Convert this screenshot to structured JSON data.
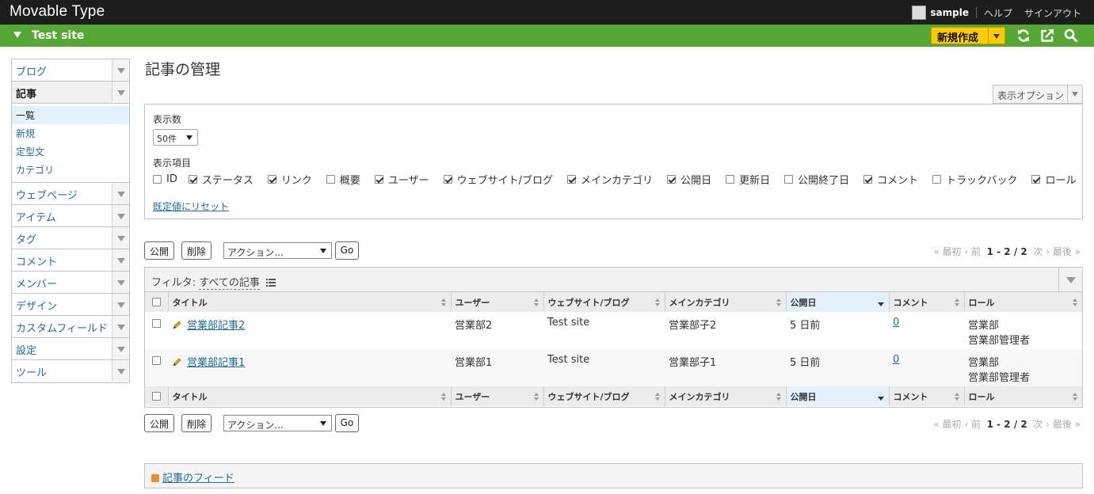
{
  "app": {
    "title": "Movable Type"
  },
  "user": {
    "name": "sample",
    "help": "ヘルプ",
    "signout": "サインアウト"
  },
  "site": {
    "name": "Test site",
    "new_button": "新規作成"
  },
  "sidebar": {
    "items": [
      {
        "label": "ブログ"
      },
      {
        "label": "記事"
      },
      {
        "label": "ウェブページ"
      },
      {
        "label": "アイテム"
      },
      {
        "label": "タグ"
      },
      {
        "label": "コメント"
      },
      {
        "label": "メンバー"
      },
      {
        "label": "デザイン"
      },
      {
        "label": "カスタムフィールド"
      },
      {
        "label": "設定"
      },
      {
        "label": "ツール"
      }
    ],
    "subitems": [
      {
        "label": "一覧"
      },
      {
        "label": "新規"
      },
      {
        "label": "定型文"
      },
      {
        "label": "カテゴリ"
      }
    ]
  },
  "page": {
    "title": "記事の管理",
    "display_options": "表示オプション"
  },
  "options": {
    "per_page_label": "表示数",
    "per_page_value": "50件",
    "columns_label": "表示項目",
    "columns": [
      {
        "label": "ID",
        "checked": false
      },
      {
        "label": "ステータス",
        "checked": true
      },
      {
        "label": "リンク",
        "checked": true
      },
      {
        "label": "概要",
        "checked": false
      },
      {
        "label": "ユーザー",
        "checked": true
      },
      {
        "label": "ウェブサイト/ブログ",
        "checked": true
      },
      {
        "label": "メインカテゴリ",
        "checked": true
      },
      {
        "label": "公開日",
        "checked": true
      },
      {
        "label": "更新日",
        "checked": false
      },
      {
        "label": "公開終了日",
        "checked": false
      },
      {
        "label": "コメント",
        "checked": true
      },
      {
        "label": "トラックバック",
        "checked": false
      },
      {
        "label": "ロール",
        "checked": true
      }
    ],
    "reset_label": "既定値にリセット"
  },
  "actions": {
    "publish": "公開",
    "delete": "削除",
    "action_select": "アクション...",
    "go": "Go",
    "pager": {
      "first": "« 最初",
      "prev": "‹ 前",
      "range": "1 - 2 / 2",
      "next": "次 ›",
      "last": "最後 »"
    }
  },
  "filter": {
    "label": "フィルタ:",
    "value": "すべての記事"
  },
  "table": {
    "headers": [
      "タイトル",
      "ユーザー",
      "ウェブサイト/ブログ",
      "メインカテゴリ",
      "公開日",
      "コメント",
      "ロール"
    ],
    "rows": [
      {
        "title": "営業部記事2",
        "user": "営業部2",
        "site": "Test site",
        "category": "営業部子2",
        "date": "5 日前",
        "comments": "0",
        "role1": "営業部",
        "role2": "営業部管理者"
      },
      {
        "title": "営業部記事1",
        "user": "営業部1",
        "site": "Test site",
        "category": "営業部子1",
        "date": "5 日前",
        "comments": "0",
        "role1": "営業部",
        "role2": "営業部管理者"
      }
    ]
  },
  "feed": {
    "label": "記事のフィード"
  },
  "icons": {
    "refresh": "refresh-icon",
    "external": "external-link-icon",
    "search": "search-icon",
    "edit": "pencil-icon",
    "feed": "rss-icon",
    "filter_list": "list-icon"
  },
  "colors": {
    "topbar": "#1d1d1d",
    "sitebar": "#55a833",
    "new_button": "#ffcb05",
    "link": "#1d6d9e"
  }
}
